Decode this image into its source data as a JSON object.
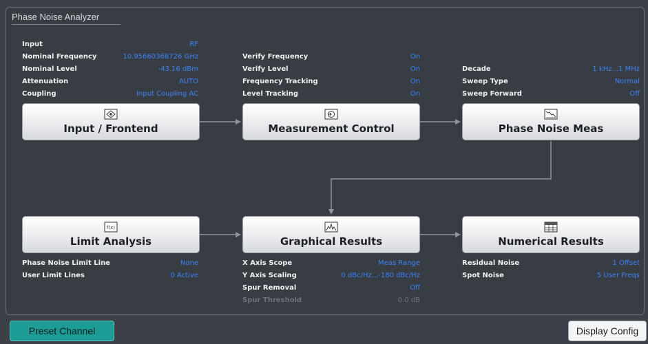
{
  "panel": {
    "title": "Phase Noise Analyzer"
  },
  "input_info": [
    {
      "label": "Input",
      "value": "RF"
    },
    {
      "label": "Nominal Frequency",
      "value": "10.95660368726 GHz"
    },
    {
      "label": "Nominal Level",
      "value": "-43.16 dBm"
    },
    {
      "label": "Attenuation",
      "value": "AUTO"
    },
    {
      "label": "Coupling",
      "value": "Input Coupling AC"
    }
  ],
  "meas_info": [
    {
      "label": "Verify Frequency",
      "value": "On"
    },
    {
      "label": "Verify Level",
      "value": "On"
    },
    {
      "label": "Frequency Tracking",
      "value": "On"
    },
    {
      "label": "Level Tracking",
      "value": "On"
    }
  ],
  "pn_info": [
    {
      "label": "Decade",
      "value": "1 kHz...1 MHz"
    },
    {
      "label": "Sweep Type",
      "value": "Normal"
    },
    {
      "label": "Sweep Forward",
      "value": "Off"
    }
  ],
  "limit_info": [
    {
      "label": "Phase Noise Limit Line",
      "value": "None"
    },
    {
      "label": "User Limit Lines",
      "value": "0 Active"
    }
  ],
  "graph_info": [
    {
      "label": "X Axis Scope",
      "value": "Meas Range"
    },
    {
      "label": "Y Axis Scaling",
      "value": "0 dBc/Hz...-180 dBc/Hz"
    },
    {
      "label": "Spur Removal",
      "value": "Off"
    },
    {
      "label": "Spur Threshold",
      "value": "0.0 dB"
    }
  ],
  "num_info": [
    {
      "label": "Residual Noise",
      "value": "1 Offset"
    },
    {
      "label": "Spot Noise",
      "value": "5 User Freqs"
    }
  ],
  "blocks": {
    "input": "Input / Frontend",
    "meas": "Measurement Control",
    "pn": "Phase Noise Meas",
    "limit": "Limit Analysis",
    "graph": "Graphical Results",
    "num": "Numerical Results"
  },
  "icons": {
    "input": "input-frontend-icon",
    "meas": "measurement-control-icon",
    "pn": "phase-noise-meas-icon",
    "limit": "limit-analysis-icon",
    "graph": "graphical-results-icon",
    "num": "numerical-results-icon"
  },
  "buttons": {
    "preset": "Preset Channel",
    "display": "Display Config"
  },
  "colors": {
    "value_blue": "#3b82f6",
    "preset_teal": "#1d9c95",
    "background": "#3c4148"
  }
}
